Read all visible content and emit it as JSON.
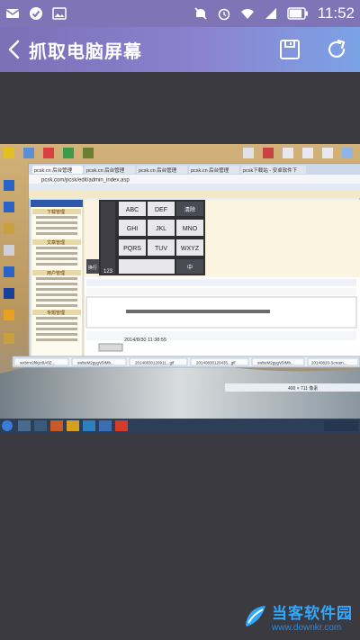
{
  "status_bar": {
    "time": "11:52",
    "icons": [
      "email-icon",
      "check-icon",
      "image-icon",
      "mute-icon",
      "alarm-icon",
      "wifi-icon",
      "signal-icon",
      "battery-icon"
    ],
    "battery_level": 0.85
  },
  "app_bar": {
    "title": "抓取电脑屏幕",
    "back_icon": "chevron-left-icon",
    "actions": [
      "save-icon",
      "refresh-icon"
    ]
  },
  "screenshot": {
    "url": "pcsk.com/pcsk/edit/admin_index.asp",
    "tab_labels": [
      "pcsk.cn 后台管理",
      "pcsk.cn 后台管理",
      "pcsk.cn 后台管理",
      "pcsk.cn 后台管理",
      "pcsk下载站 - 安卓软件下"
    ],
    "keypad": {
      "keys": [
        "ABC",
        "DEF",
        "GHI",
        "JKL",
        "MNO",
        "PQRS",
        "TUV",
        "WXYZ"
      ],
      "special": [
        "123",
        "中",
        "清除",
        "换行"
      ]
    },
    "sidebar_labels": [
      "下载管理",
      "文章管理",
      "用户管理",
      "专题管理"
    ],
    "time_text": "2014/8/30 11:38:55",
    "taskbar_items": [
      "wxbmr2hkjzi9A0Z...",
      "swbeM2gygV5tMb...",
      "20140830120911...gif",
      "20140830120435...gif",
      "swbeM2gygV5tMb...",
      "20140820-Screen..."
    ],
    "resolution_text": "400 × 711 像素"
  },
  "watermark": {
    "cn": "当客软件园",
    "en": "www.downkr.com"
  },
  "colors": {
    "status_bar": "#7e74b6",
    "app_bar_start": "#7b6fb6",
    "app_bar_end": "#7ca2e6",
    "canvas": "#3b3a40",
    "watermark": "#2ea9ff"
  }
}
